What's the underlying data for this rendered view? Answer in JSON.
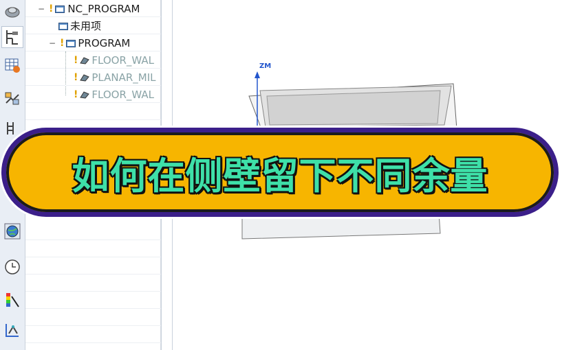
{
  "navigator": {
    "nodes": [
      {
        "label": "NC_PROGRAM",
        "warn": "!",
        "grey": false
      },
      {
        "label": "未用项",
        "warn": "",
        "grey": false
      },
      {
        "label": "PROGRAM",
        "warn": "!",
        "grey": false
      },
      {
        "label": "FLOOR_WAL",
        "warn": "!",
        "grey": true
      },
      {
        "label": "PLANAR_MIL",
        "warn": "!",
        "grey": true
      },
      {
        "label": "FLOOR_WAL",
        "warn": "!",
        "grey": true
      }
    ]
  },
  "viewport": {
    "axis_label": "ZM"
  },
  "banner": {
    "text": "如何在侧壁留下不同余量"
  },
  "colors": {
    "banner_fill": "#f7b500",
    "banner_border": "#3b1f8a",
    "banner_text": "#3ee0a8"
  }
}
